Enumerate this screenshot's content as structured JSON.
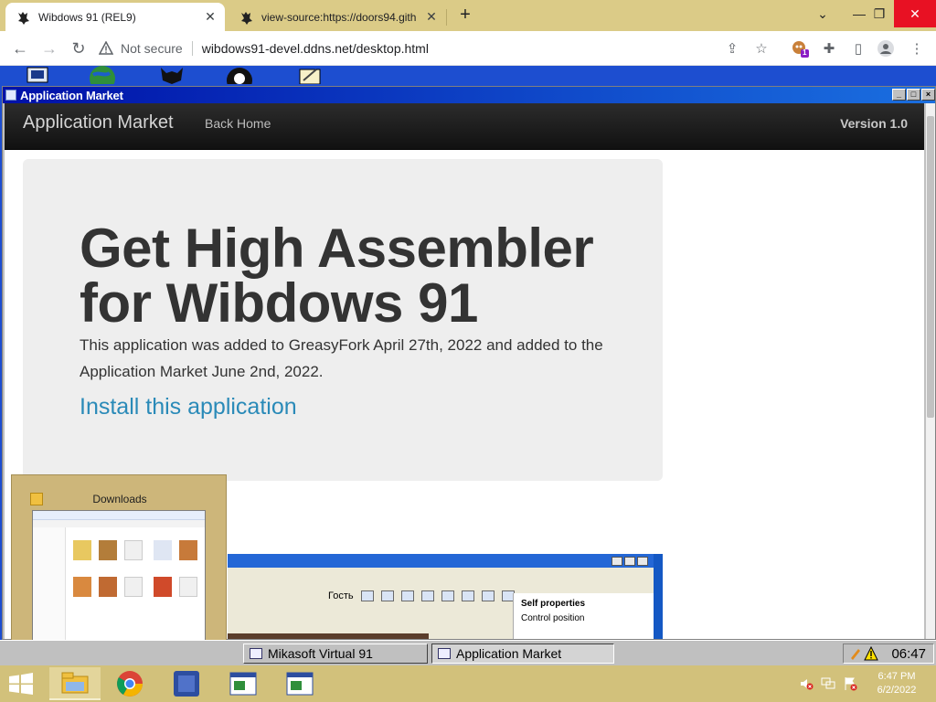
{
  "browser": {
    "tabs": [
      {
        "title": "Wibdows 91 (REL9)",
        "active": true
      },
      {
        "title": "view-source:https://doors94.gith",
        "active": false
      }
    ],
    "new_tab": "+",
    "window_controls": {
      "dropdown": "⌄",
      "minimize": "—",
      "restore": "❐",
      "close": "✕"
    },
    "omnibox": {
      "security_text": "Not secure",
      "url": "wibdows91-devel.ddns.net/desktop.html"
    },
    "extension_badge": "1"
  },
  "app_window": {
    "title": "Application Market",
    "controls": [
      "_",
      "□",
      "×"
    ]
  },
  "page": {
    "navbar": {
      "brand": "Application Market",
      "link": "Back Home",
      "version": "Version 1.0"
    },
    "hero": {
      "heading": "Get High Assembler for Wibdows 91",
      "description": "This application was added to GreasyFork April 27th, 2022 and added to the Application Market June 2nd, 2022.",
      "install_link": "Install this application"
    },
    "preview": {
      "toolbar_label": "Гость",
      "props_header": "Self properties",
      "props_row": "Control position"
    }
  },
  "downloads_thumb": {
    "title": "Downloads"
  },
  "w91_taskbar": {
    "items": [
      {
        "label": "Mikasoft Virtual 91",
        "pressed": false
      },
      {
        "label": "Application Market",
        "pressed": true
      }
    ],
    "clock": "06:47"
  },
  "win8_taskbar": {
    "time": "6:47 PM",
    "date": "6/2/2022"
  },
  "colors": {
    "tabstrip": "#dbcb87",
    "desktop": "#1d4ed0",
    "titlebar_start": "#0011a8",
    "link": "#2a8ab8",
    "win8_taskbar": "#d2c17b"
  }
}
